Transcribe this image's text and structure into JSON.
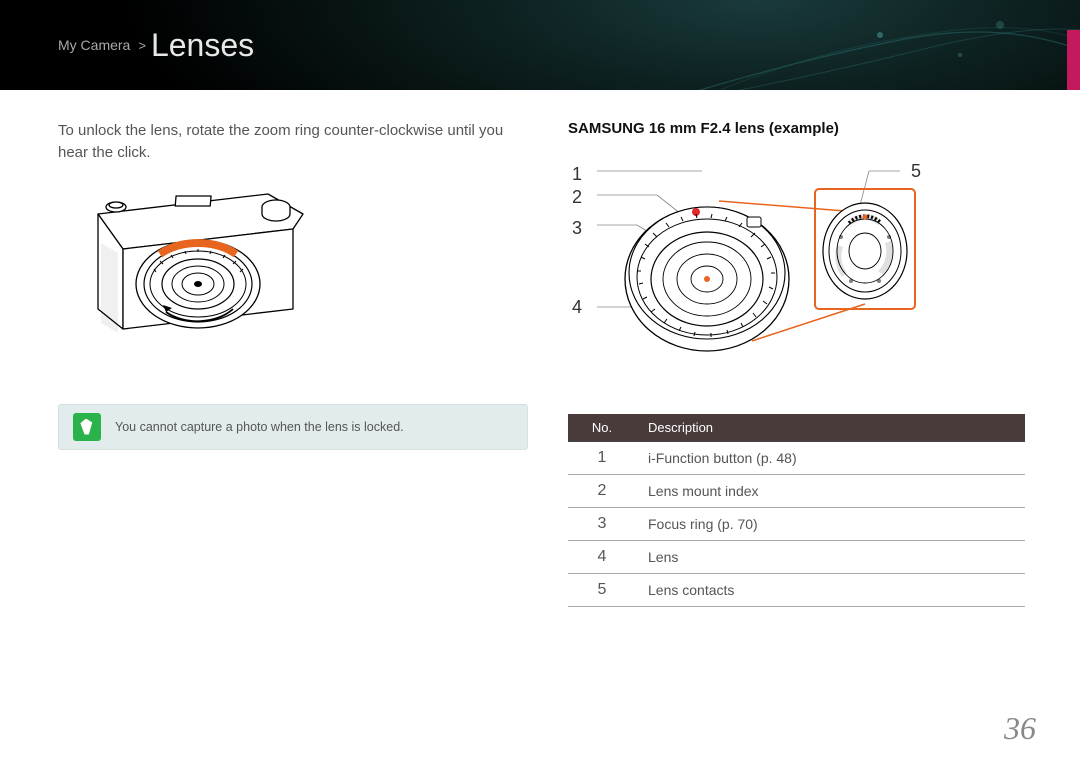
{
  "header": {
    "breadcrumb": "My Camera",
    "arrow": ">",
    "title": "Lenses"
  },
  "left": {
    "intro": "To unlock the lens, rotate the zoom ring counter-clockwise until you hear the click.",
    "note": "You cannot capture a photo when the lens is locked."
  },
  "right": {
    "title": "SAMSUNG 16 mm F2.4 lens (example)",
    "labels": {
      "n1": "1",
      "n2": "2",
      "n3": "3",
      "n4": "4",
      "n5": "5"
    },
    "table": {
      "headers": {
        "no": "No.",
        "desc": "Description"
      },
      "rows": [
        {
          "no": "1",
          "desc": "i-Function button (p. 48)"
        },
        {
          "no": "2",
          "desc": "Lens mount index"
        },
        {
          "no": "3",
          "desc": "Focus ring (p. 70)"
        },
        {
          "no": "4",
          "desc": "Lens"
        },
        {
          "no": "5",
          "desc": "Lens contacts"
        }
      ]
    }
  },
  "page_number": "36"
}
